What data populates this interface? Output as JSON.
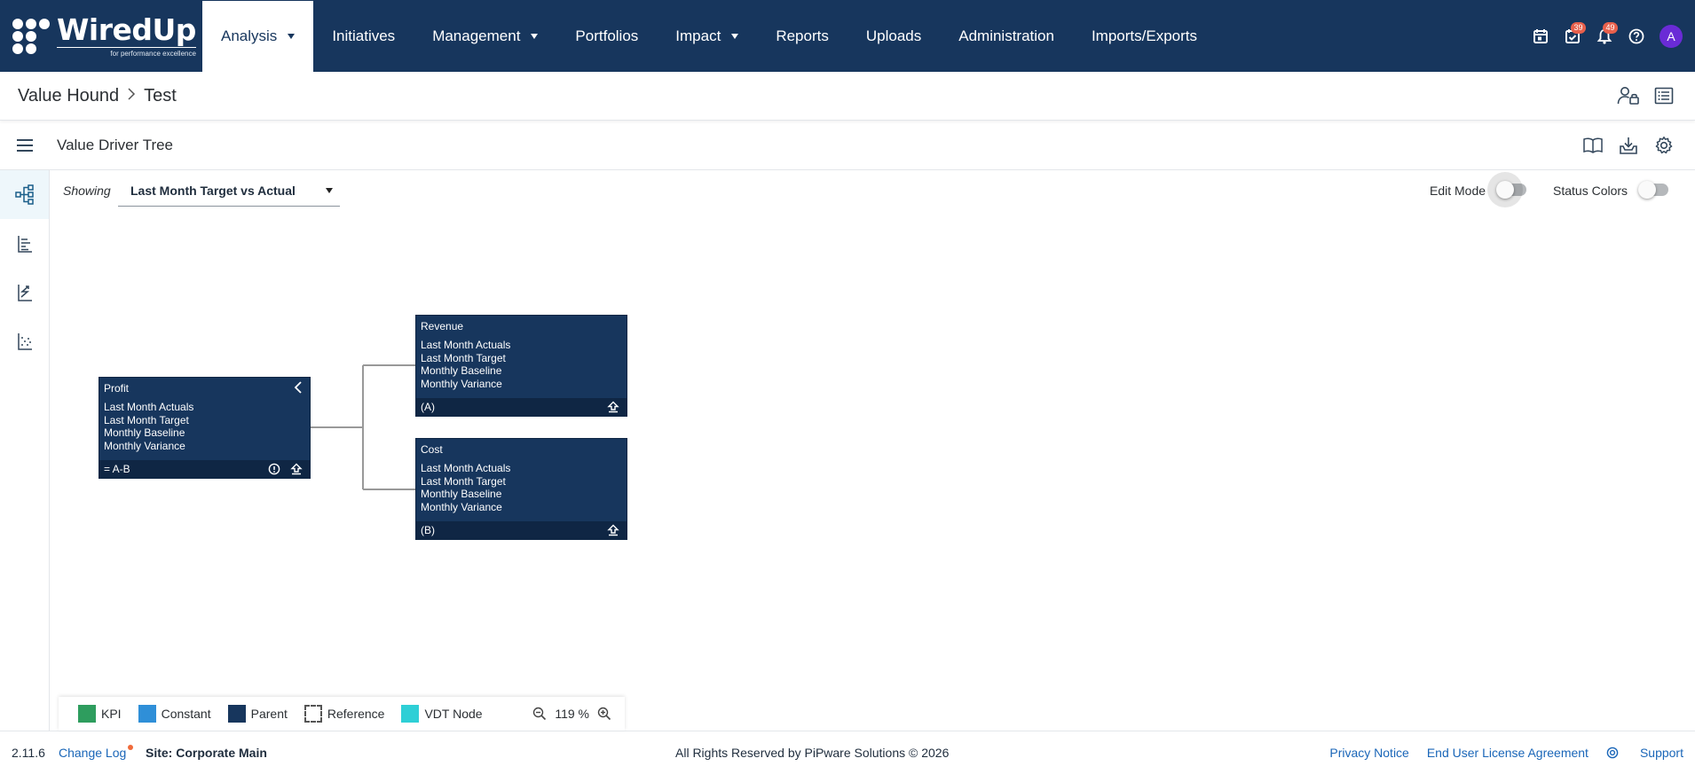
{
  "app": {
    "logo_text": "WiredUp",
    "logo_tagline": "for performance excellence"
  },
  "nav": {
    "items": [
      {
        "label": "Analysis",
        "active": true,
        "dropdown": true
      },
      {
        "label": "Initiatives",
        "dropdown": false
      },
      {
        "label": "Management",
        "dropdown": true
      },
      {
        "label": "Portfolios",
        "dropdown": false
      },
      {
        "label": "Impact",
        "dropdown": true
      },
      {
        "label": "Reports",
        "dropdown": false
      },
      {
        "label": "Uploads",
        "dropdown": false
      },
      {
        "label": "Administration",
        "dropdown": false
      },
      {
        "label": "Imports/Exports",
        "dropdown": false
      }
    ],
    "tasks_badge": "39",
    "notifications_badge": "49",
    "avatar_initial": "A"
  },
  "breadcrumb": {
    "items": [
      "Value Hound",
      "Test"
    ]
  },
  "page": {
    "title": "Value Driver Tree"
  },
  "toolbar": {
    "showing_label": "Showing",
    "showing_value": "Last Month Target vs Actual",
    "edit_mode_label": "Edit Mode",
    "status_colors_label": "Status Colors",
    "edit_mode_on": false,
    "status_colors_on": false
  },
  "tree": {
    "nodes": [
      {
        "title": "Profit",
        "lines": [
          "Last Month Actuals",
          "Last Month Target",
          "Monthly Baseline",
          "Monthly Variance"
        ],
        "footer": "= A-B"
      },
      {
        "title": "Revenue",
        "lines": [
          "Last Month Actuals",
          "Last Month Target",
          "Monthly Baseline",
          "Monthly Variance"
        ],
        "footer": "(A)"
      },
      {
        "title": "Cost",
        "lines": [
          "Last Month Actuals",
          "Last Month Target",
          "Monthly Baseline",
          "Monthly Variance"
        ],
        "footer": "(B)"
      }
    ]
  },
  "legend": {
    "items": [
      {
        "label": "KPI",
        "color": "#2e9d5e"
      },
      {
        "label": "Constant",
        "color": "#2f8fd8"
      },
      {
        "label": "Parent",
        "color": "#17365d"
      },
      {
        "label": "Reference",
        "color": "#ffffff"
      },
      {
        "label": "VDT Node",
        "color": "#2ecfd6"
      }
    ],
    "zoom_value": "119 %"
  },
  "footer": {
    "version": "2.11.6",
    "change_log": "Change Log",
    "site": "Site: Corporate Main",
    "copyright": "All Rights Reserved by PiPware Solutions © 2026",
    "privacy": "Privacy Notice",
    "eula": "End User License Agreement",
    "support": "Support"
  },
  "colors": {
    "brand_navy": "#17365d",
    "node_footer": "#0f2644",
    "link_blue": "#1a66b8",
    "badge_red": "#e8604c",
    "avatar_purple": "#6a2bd6"
  }
}
